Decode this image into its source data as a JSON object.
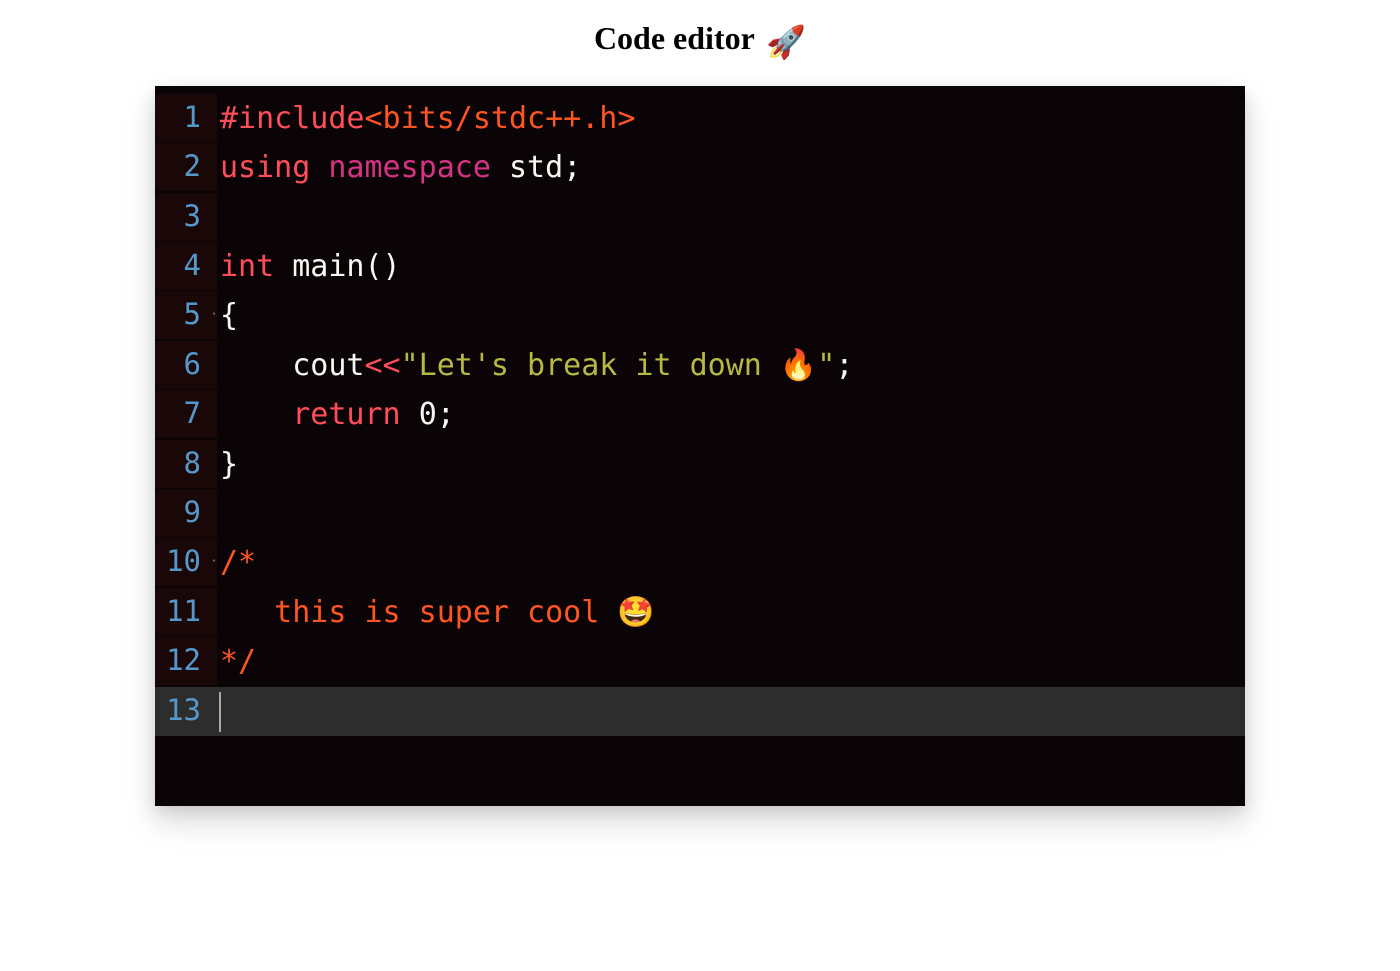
{
  "heading": {
    "text": "Code editor",
    "icon": "🚀"
  },
  "editor": {
    "lines": [
      {
        "num": "1",
        "fold": "",
        "tokens": [
          {
            "cls": "tk-preprocessor",
            "text": "#include"
          },
          {
            "cls": "tk-include-path",
            "text": "<bits/stdc++.h>"
          }
        ]
      },
      {
        "num": "2",
        "fold": "",
        "tokens": [
          {
            "cls": "tk-keyword-using",
            "text": "using"
          },
          {
            "cls": "",
            "text": " "
          },
          {
            "cls": "tk-keyword-namespace",
            "text": "namespace"
          },
          {
            "cls": "",
            "text": " "
          },
          {
            "cls": "tk-namespace-name",
            "text": "std"
          },
          {
            "cls": "tk-punct",
            "text": ";"
          }
        ]
      },
      {
        "num": "3",
        "fold": "",
        "tokens": []
      },
      {
        "num": "4",
        "fold": "",
        "tokens": [
          {
            "cls": "tk-keyword-type",
            "text": "int"
          },
          {
            "cls": "",
            "text": " "
          },
          {
            "cls": "tk-function-name",
            "text": "main"
          },
          {
            "cls": "tk-punct",
            "text": "()"
          }
        ]
      },
      {
        "num": "5",
        "fold": "·",
        "tokens": [
          {
            "cls": "tk-brace",
            "text": "{"
          }
        ]
      },
      {
        "num": "6",
        "fold": "",
        "tokens": [
          {
            "cls": "",
            "text": "    "
          },
          {
            "cls": "tk-cout",
            "text": "cout"
          },
          {
            "cls": "tk-operator",
            "text": "<<"
          },
          {
            "cls": "tk-string",
            "text": "\"Let's break it down 🔥\""
          },
          {
            "cls": "tk-punct",
            "text": ";"
          }
        ]
      },
      {
        "num": "7",
        "fold": "",
        "tokens": [
          {
            "cls": "",
            "text": "    "
          },
          {
            "cls": "tk-keyword-return",
            "text": "return"
          },
          {
            "cls": "",
            "text": " "
          },
          {
            "cls": "tk-number",
            "text": "0"
          },
          {
            "cls": "tk-punct",
            "text": ";"
          }
        ]
      },
      {
        "num": "8",
        "fold": "",
        "tokens": [
          {
            "cls": "tk-brace",
            "text": "}"
          }
        ]
      },
      {
        "num": "9",
        "fold": "",
        "tokens": []
      },
      {
        "num": "10",
        "fold": "·",
        "tokens": [
          {
            "cls": "tk-comment",
            "text": "/*"
          }
        ]
      },
      {
        "num": "11",
        "fold": "",
        "tokens": [
          {
            "cls": "tk-comment",
            "text": "   this is super cool 🤩"
          }
        ]
      },
      {
        "num": "12",
        "fold": "",
        "tokens": [
          {
            "cls": "tk-comment",
            "text": "*/"
          }
        ]
      },
      {
        "num": "13",
        "fold": "",
        "current": true,
        "cursor": true,
        "tokens": []
      }
    ]
  }
}
